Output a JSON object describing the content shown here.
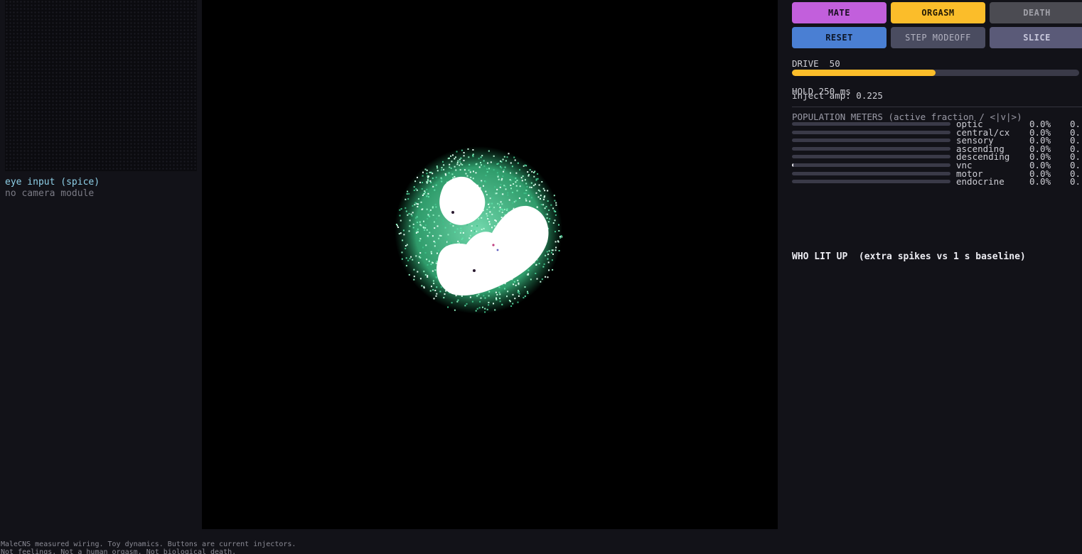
{
  "eye": {
    "title": "eye input (spice)",
    "status": "no camera module"
  },
  "controls": {
    "buttons": {
      "mate": "MATE",
      "orgasm": "ORGASM",
      "death": "DEATH",
      "reset": "RESET",
      "step_mode": "STEP MODEOFF",
      "slice": "SLICE"
    },
    "drive": {
      "label": "DRIVE  50",
      "fraction": 0.5
    },
    "hold_label": "HOLD 250 ms",
    "inject_label": "inject amp: 0.225"
  },
  "meters": {
    "title": "POPULATION METERS (active fraction / <|v|>)",
    "rows": [
      {
        "name": "optic",
        "pct": "0.0%",
        "v": "0.",
        "fraction": 0.0
      },
      {
        "name": "central/cx",
        "pct": "0.0%",
        "v": "0.",
        "fraction": 0.0
      },
      {
        "name": "sensory",
        "pct": "0.0%",
        "v": "0.",
        "fraction": 0.0
      },
      {
        "name": "ascending",
        "pct": "0.0%",
        "v": "0.",
        "fraction": 0.0
      },
      {
        "name": "descending",
        "pct": "0.0%",
        "v": "0.",
        "fraction": 0.0
      },
      {
        "name": "vnc",
        "pct": "0.0%",
        "v": "0.",
        "fraction": 0.004
      },
      {
        "name": "motor",
        "pct": "0.0%",
        "v": "0.",
        "fraction": 0.0
      },
      {
        "name": "endocrine",
        "pct": "0.0%",
        "v": "0.",
        "fraction": 0.0
      }
    ]
  },
  "who_lit_up": {
    "title": "WHO LIT UP  (extra spikes vs 1 s baseline)"
  },
  "footer": {
    "line1": "MaleCNS measured wiring. Toy dynamics. Buttons are current injectors.",
    "line2": "Not feelings. Not a human orgasm. Not biological death."
  },
  "colors": {
    "mate": "#c25fdc",
    "orgasm": "#fbbd2a",
    "death": "#4b4b52",
    "reset": "#4a7fd3",
    "neuron_glow": "#5fe0a8"
  }
}
